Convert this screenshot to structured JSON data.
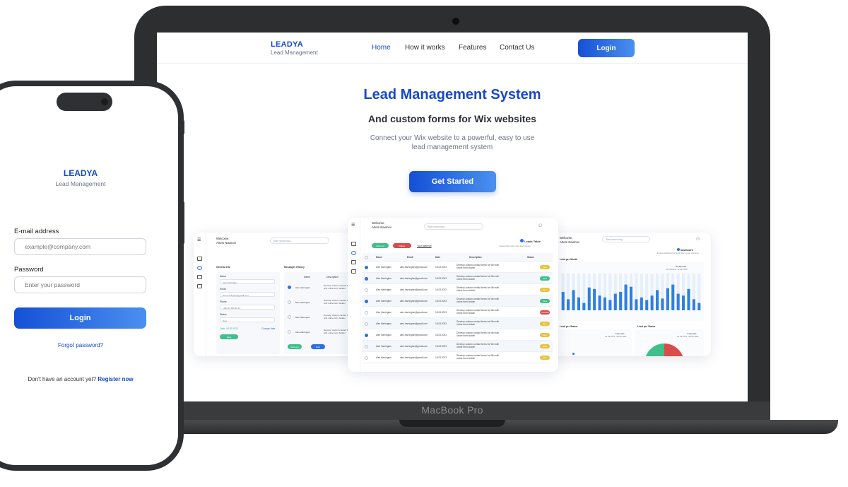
{
  "laptop": {
    "device_label": "MacBook Pro",
    "nav": {
      "logo_name": "LEADYA",
      "logo_sub": "Lead Management",
      "links": [
        "Home",
        "How it works",
        "Features",
        "Contact Us"
      ],
      "login_label": "Login"
    },
    "hero": {
      "title": "Lead Management System",
      "subtitle": "And custom forms for Wix websites",
      "description": "Connect your Wix website to a powerful, easy to use lead management system",
      "cta": "Get Started"
    },
    "center_dashboard": {
      "welcome": "Welcome,",
      "user": "Artem Naumov",
      "search_placeholder": "Start searching...",
      "add_button": "Add new",
      "delete_button": "Delete",
      "tab_label": "Your table/set",
      "table_title": "Leads Table",
      "table_sub": "Create fully customized lead reports",
      "columns": [
        "Name",
        "Email",
        "Date",
        "Description",
        "Status"
      ],
      "rows": [
        {
          "name": "Alex Harrington",
          "email": "alex-harrington@gmail.com",
          "date": "18.03.2023",
          "desc": "Develop custom contact forms for Wix with online form builder",
          "status": "New",
          "checked": true
        },
        {
          "name": "Alex Harrington",
          "email": "alex-harrington@gmail.com",
          "date": "18.03.2023",
          "desc": "Develop custom contact forms for Wix with online form builder",
          "status": "Done",
          "checked": true
        },
        {
          "name": "Alex Harrington",
          "email": "alex-harrington@gmail.com",
          "date": "18.03.2023",
          "desc": "Develop custom contact forms for Wix with online form builder",
          "status": "New",
          "checked": false
        },
        {
          "name": "Alex Harrington",
          "email": "alex-harrington@gmail.com",
          "date": "18.03.2023",
          "desc": "Develop custom contact forms for Wix with online form builder",
          "status": "Done",
          "checked": true
        },
        {
          "name": "Alex Harrington",
          "email": "alex-harrington@gmail.com",
          "date": "18.03.2023",
          "desc": "Develop custom contact forms for Wix with online form builder",
          "status": "Canceled",
          "checked": false
        },
        {
          "name": "Alex Harrington",
          "email": "alex-harrington@gmail.com",
          "date": "18.03.2023",
          "desc": "Develop custom contact forms for Wix with online form builder",
          "status": "New",
          "checked": false
        },
        {
          "name": "Alex Harrington",
          "email": "alex-harrington@gmail.com",
          "date": "18.03.2023",
          "desc": "Develop custom contact forms for Wix with online form builder",
          "status": "New",
          "checked": true
        },
        {
          "name": "Alex Harrington",
          "email": "alex-harrington@gmail.com",
          "date": "18.03.2023",
          "desc": "Develop custom contact forms for Wix with online form builder",
          "status": "New",
          "checked": false
        },
        {
          "name": "Alex Harrington",
          "email": "alex-harrington@gmail.com",
          "date": "18.03.2023",
          "desc": "Develop custom contact forms for Wix with online form builder",
          "status": "New",
          "checked": false
        }
      ],
      "status_colors": {
        "New": "#e8c33a",
        "Done": "#3fbf8a",
        "Canceled": "#d94c4c"
      }
    },
    "left_dashboard": {
      "welcome": "Welcome,",
      "user": "Artem Naumov",
      "search_placeholder": "Start searching...",
      "general_info": "General info",
      "messages_history": "Messages History",
      "fields": [
        {
          "label": "Name",
          "value": "Alex Harrington"
        },
        {
          "label": "Email",
          "value": "alex-harrington@gmail.com"
        },
        {
          "label": "Phone",
          "value": "+380 63 569 96 14"
        },
        {
          "label": "Status",
          "value": "New"
        }
      ],
      "date_label": "Date: 18.03.2023",
      "change_date": "Change date",
      "save": "Save",
      "msg_columns": [
        "Name",
        "Description"
      ],
      "msg_rows": [
        "Alex Harrington",
        "Alex Harrington",
        "Alex Harrington",
        "Alex Harrington"
      ],
      "msg_desc": "Develop custom contact forms for Wix with online form builder",
      "add_new": "Add new",
      "edit": "Edit"
    },
    "right_dashboard": {
      "welcome": "Welcome,",
      "user": "Artem Naumov",
      "search_placeholder": "Start searching...",
      "title": "Dashboard",
      "subtitle": "Explore dashboard for quick look to main indicators",
      "chart1_label": "Lead per Month",
      "chart1_range_title": "30 days last",
      "chart1_range": "01.03.2023 - 31.03.2023",
      "chart2_label": "Lead per Status",
      "chart2_range_title": "7 days last",
      "chart2_range": "01.03.2023 - 08.03.2023",
      "chart3_label": "Lead per Status",
      "chart3_range_title": "7 days last",
      "chart3_range": "01.03.2023 - 08.03.2023"
    }
  },
  "phone": {
    "logo_name": "LEADYA",
    "logo_sub": "Lead Management",
    "email_label": "E-mail address",
    "email_placeholder": "example@company.com",
    "password_label": "Password",
    "password_placeholder": "Enter your password",
    "login_label": "Login",
    "forgot": "Forgot password?",
    "register_prompt": "Don't have an account yet?",
    "register_link": "Register now"
  },
  "chart_data": {
    "type": "bar",
    "values": [
      50,
      30,
      55,
      35,
      20,
      62,
      58,
      40,
      35,
      28,
      45,
      50,
      70,
      64,
      30,
      35,
      28,
      40,
      55,
      32,
      60,
      70,
      45,
      40,
      58,
      30,
      20
    ],
    "ylim": [
      0,
      100
    ]
  }
}
